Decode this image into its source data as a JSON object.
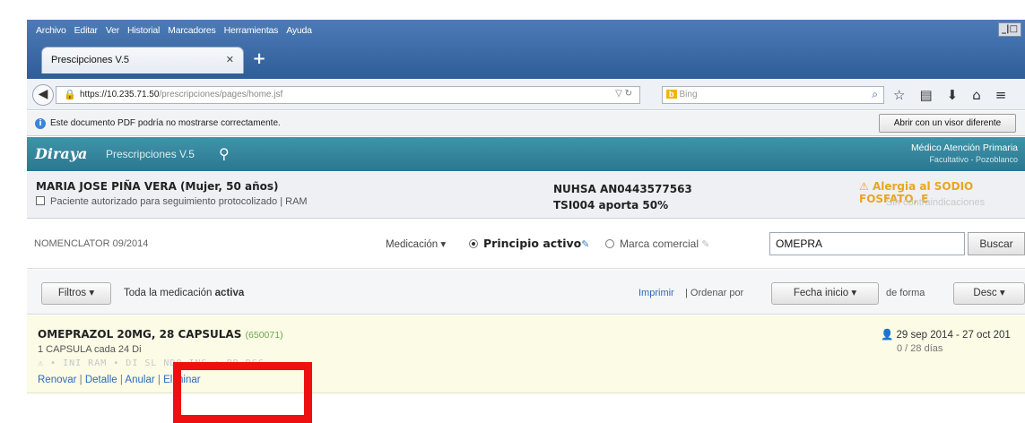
{
  "browser": {
    "menu": [
      "Archivo",
      "Editar",
      "Ver",
      "Historial",
      "Marcadores",
      "Herramientas",
      "Ayuda"
    ],
    "tab_title": "Prescipciones V.5",
    "url_host": "https://10.235.71.50",
    "url_path": "/prescripciones/pages/home.jsf",
    "search_placeholder": "Bing",
    "info_text": "Este documento PDF podría no mostrarse correctamente.",
    "pdf_button": "Abrir con un visor diferente"
  },
  "app": {
    "logo": "Diraya",
    "name": "Prescripciones V.5",
    "role": "Médico Atención Primaria",
    "role_sub": "Facultativo - Pozoblanco"
  },
  "patient": {
    "name": "MARIA JOSE PIÑA VERA (Mujer, 50 años)",
    "checkbox_label": "Paciente autorizado para seguimiento protocolizado",
    "ram": "RAM",
    "nuhsa": "NUHSA AN0443577563",
    "aporta": "TSI004 aporta 50%",
    "alert": "Alergia al SODIO FOSFATO, E",
    "contraindicaciones": "Sin contraindicaciones"
  },
  "search": {
    "nomenclator": "NOMENCLATOR 09/2014",
    "medicacion": "Medicación",
    "principio": "Principio activo",
    "marca": "Marca comercial",
    "query": "OMEPRA",
    "button": "Buscar"
  },
  "filters": {
    "filtros": "Filtros",
    "toda_prefix": "Toda la medicación",
    "toda_bold": "activa",
    "imprimir": "Imprimir",
    "ordenar": "| Ordenar por",
    "fecha": "Fecha inicio",
    "de_forma": "de forma",
    "desc": "Desc"
  },
  "drug": {
    "name": "OMEPRAZOL 20MG, 28 CAPSULAS",
    "code": "(650071)",
    "dose": "1 CAPSULA cada 24 Di",
    "tags": "INI RAM • DI SL NDO INS • PR RSC",
    "actions": [
      "Renovar",
      "Detalle",
      "Anular",
      "Eliminar"
    ],
    "dates": "29 sep 2014 - 27 oct 201",
    "days": "0 / 28 días"
  }
}
